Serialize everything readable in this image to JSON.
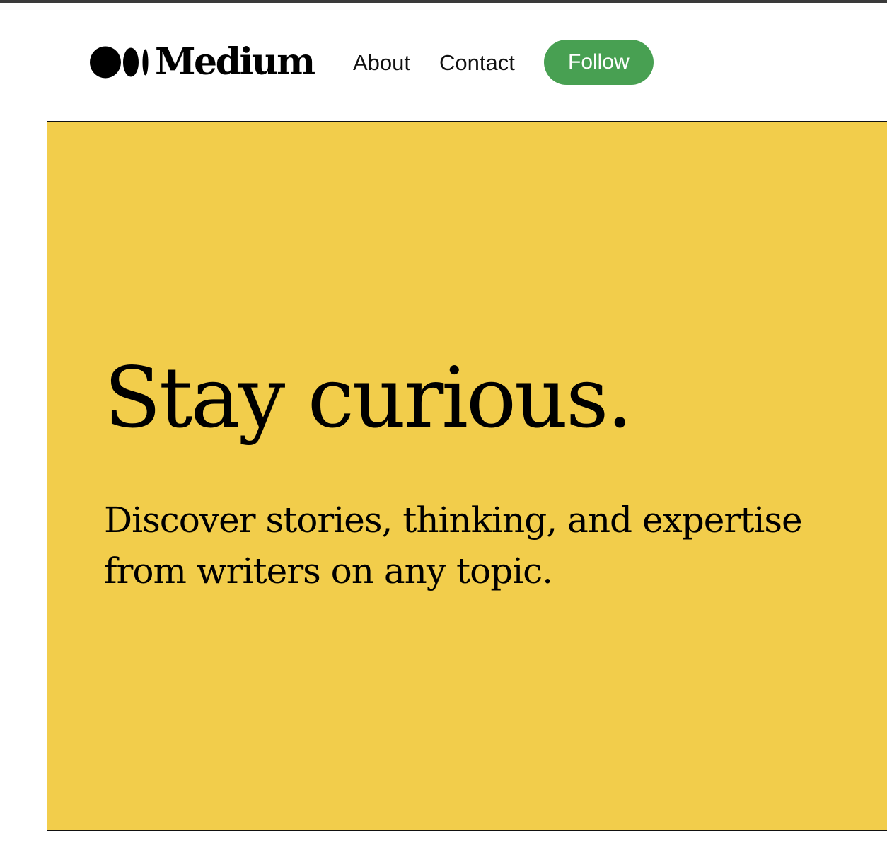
{
  "brand": {
    "name": "Medium",
    "icon": "medium-logo-icon"
  },
  "nav": {
    "links": [
      "About",
      "Contact"
    ],
    "follow_label": "Follow",
    "follow_color": "#48a052"
  },
  "hero": {
    "title": "Stay curious.",
    "subtitle": "Discover stories, thinking, and expertise from writers on any topic.",
    "background_color": "#f2cd4b"
  }
}
